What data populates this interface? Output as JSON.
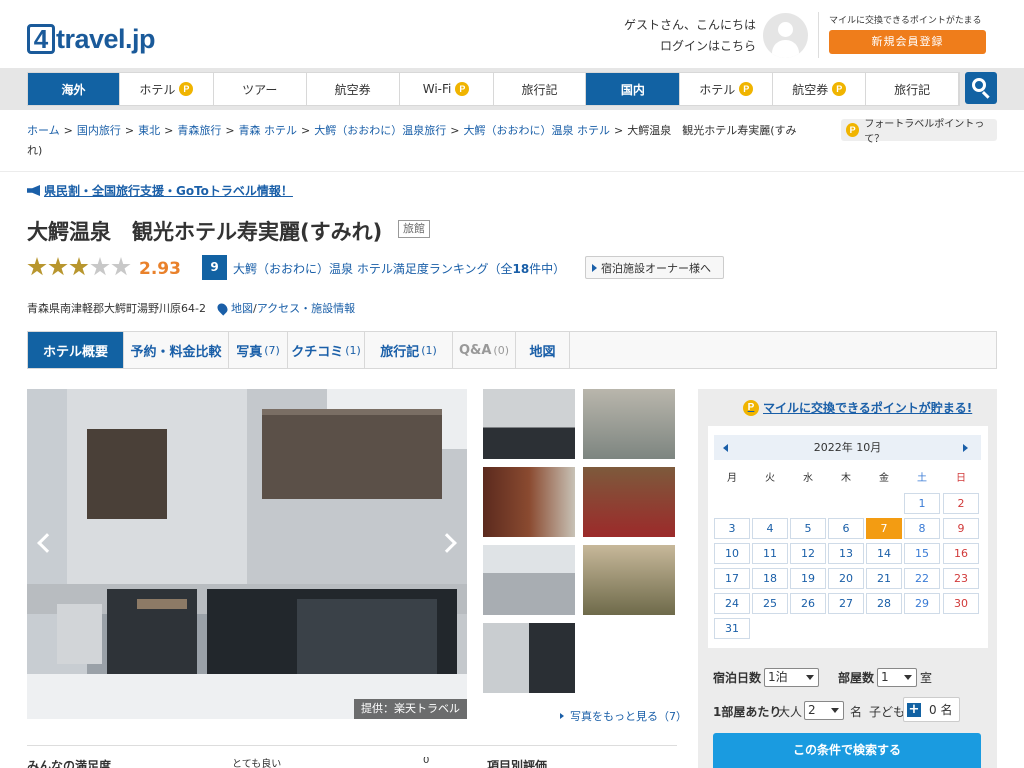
{
  "header": {
    "logo_num": "4",
    "logo_text": "travel.jp",
    "greeting_line1": "ゲストさん、こんにちは",
    "login_link": "ログインはこちら",
    "miles_note": "マイルに交換できるポイントがたまる",
    "register_button": "新規会員登録"
  },
  "nav": {
    "items": [
      {
        "label": "海外",
        "section": true
      },
      {
        "label": "ホテル",
        "point": true
      },
      {
        "label": "ツアー"
      },
      {
        "label": "航空券"
      },
      {
        "label": "Wi-Fi",
        "point": true
      },
      {
        "label": "旅行記"
      },
      {
        "label": "国内",
        "section": true
      },
      {
        "label": "ホテル",
        "point": true
      },
      {
        "label": "航空券",
        "point": true
      },
      {
        "label": "旅行記"
      }
    ],
    "point_mark": "P",
    "search_icon": "search-icon"
  },
  "breadcrumb": {
    "links": [
      "ホーム",
      "国内旅行",
      "東北",
      "青森旅行",
      "青森 ホテル",
      "大鰐（おおわに）温泉旅行",
      "大鰐（おおわに）温泉 ホテル"
    ],
    "separator": ">",
    "current": "大鰐温泉　観光ホテル寿実麗(すみれ)"
  },
  "point_help": "フォートラベルポイントって？",
  "campaign_link": "県民割・全国旅行支援・GoToトラベル情報！",
  "hotel": {
    "name": "大鰐温泉　観光ホテル寿実麗(すみれ)",
    "type": "旅館",
    "rating": 2.93,
    "rating_text": "2.93",
    "rank": "9",
    "rank_prefix": "大鰐（おおわに）温泉 ホテル満足度ランキング（全",
    "rank_total": "18",
    "rank_suffix": "件中）",
    "owner_button": "宿泊施設オーナー様へ",
    "address": "青森県南津軽郡大鰐町湯野川原64-2",
    "map_link": "地図",
    "access_sep": " / ",
    "access_link": "アクセス・施設情報"
  },
  "tabs": [
    {
      "label": "ホテル概要",
      "count": "",
      "active": true
    },
    {
      "label": "予約・料金比較",
      "count": ""
    },
    {
      "label": "写真",
      "count": "(7)"
    },
    {
      "label": "クチコミ",
      "count": "(1)"
    },
    {
      "label": "旅行記",
      "count": "(1)"
    },
    {
      "label": "Q&A",
      "count": "(0)",
      "disabled": true
    },
    {
      "label": "地図",
      "count": ""
    }
  ],
  "photo": {
    "credit": "提供：楽天トラベル",
    "more_link": "写真をもっと見る（7）"
  },
  "sidebar": {
    "title": "マイルに交換できるポイントが貯まる!",
    "calendar": {
      "month_label": "2022年 10月",
      "weekdays": [
        "月",
        "火",
        "水",
        "木",
        "金",
        "土",
        "日"
      ],
      "selected_day": "7"
    },
    "nights_label": "宿泊日数",
    "nights_value": "1泊",
    "rooms_label": "部屋数",
    "rooms_value": "1",
    "rooms_unit": "室",
    "per_room_label": "1部屋あたり",
    "adults_label": "大人",
    "adults_value": "2",
    "adults_unit": "名",
    "children_label": "子ども",
    "children_value": "0 名",
    "search_button": "この条件で検索する"
  },
  "bottom": {
    "left": "みんなの満足度",
    "mid1": "とても良い",
    "mid2": "0",
    "right": "項目別評価"
  },
  "colors": {
    "brand_blue": "#1262a3",
    "link_blue": "#1a5fa8",
    "orange": "#ef7d1b",
    "rating_orange": "#e9812b",
    "point_yellow": "#f0b400"
  }
}
